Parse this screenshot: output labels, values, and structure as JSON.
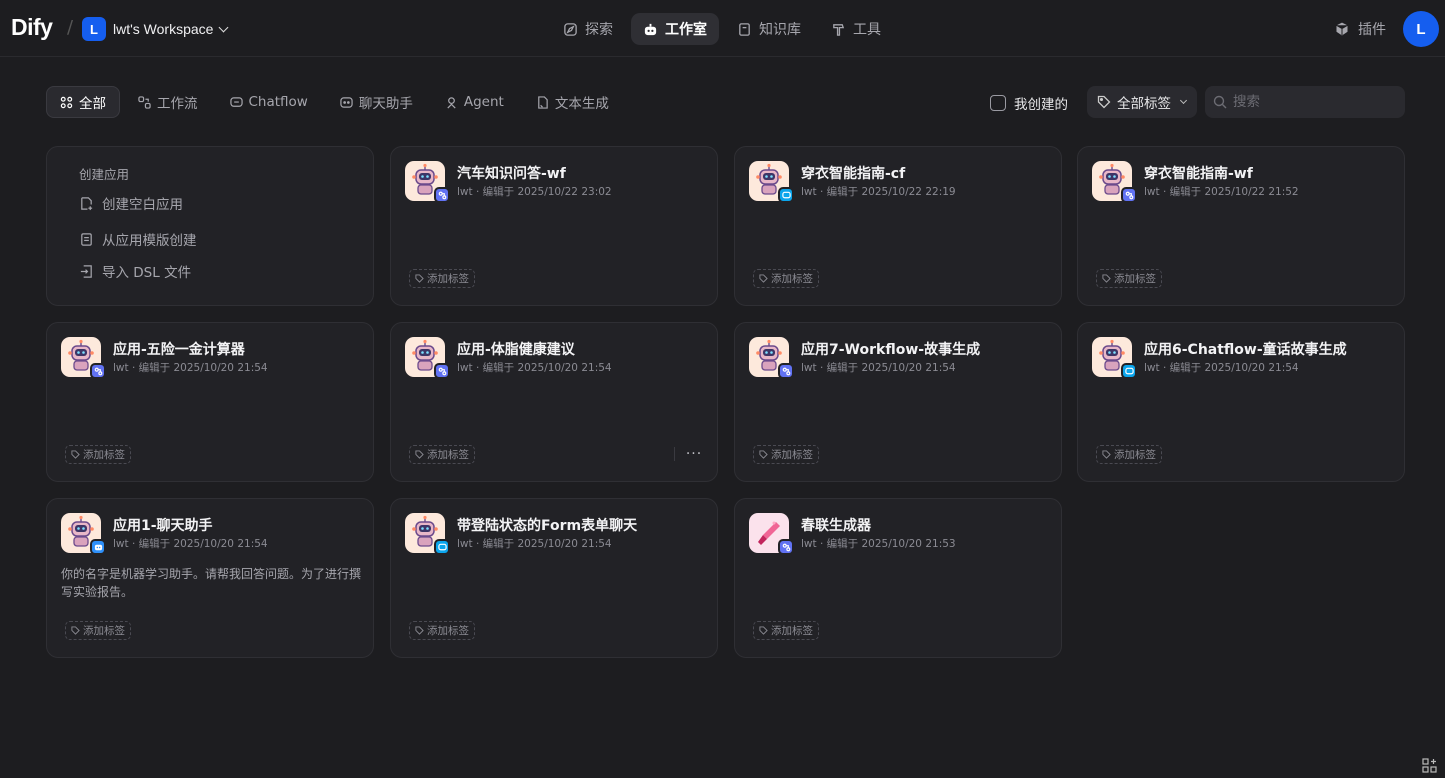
{
  "header": {
    "logo": "Dify",
    "workspace_initial": "L",
    "workspace_name": "lwt's Workspace",
    "nav": [
      {
        "label": "探索",
        "icon": "compass-icon"
      },
      {
        "label": "工作室",
        "icon": "robot-icon",
        "active": true
      },
      {
        "label": "知识库",
        "icon": "book-icon"
      },
      {
        "label": "工具",
        "icon": "hammer-icon"
      }
    ],
    "plugins_label": "插件",
    "avatar_initial": "L"
  },
  "filters": {
    "tabs": [
      {
        "label": "全部",
        "active": true
      },
      {
        "label": "工作流"
      },
      {
        "label": "Chatflow"
      },
      {
        "label": "聊天助手"
      },
      {
        "label": "Agent"
      },
      {
        "label": "文本生成"
      }
    ],
    "mine_label": "我创建的",
    "tags_label": "全部标签",
    "search_placeholder": "搜索"
  },
  "create": {
    "title": "创建应用",
    "blank": "创建空白应用",
    "template": "从应用模版创建",
    "import": "导入 DSL 文件"
  },
  "apps": [
    {
      "name": "汽车知识问答-wf",
      "meta": "lwt · 编辑于 2025/10/22 23:02",
      "type": "workflow",
      "tag": "添加标签"
    },
    {
      "name": "穿衣智能指南-cf",
      "meta": "lwt · 编辑于 2025/10/22 22:19",
      "type": "chatflow",
      "tag": "添加标签"
    },
    {
      "name": "穿衣智能指南-wf",
      "meta": "lwt · 编辑于 2025/10/22 21:52",
      "type": "workflow",
      "tag": "添加标签"
    },
    {
      "name": "应用-五险一金计算器",
      "meta": "lwt · 编辑于 2025/10/20 21:54",
      "type": "workflow",
      "tag": "添加标签"
    },
    {
      "name": "应用-体脂健康建议",
      "meta": "lwt · 编辑于 2025/10/20 21:54",
      "type": "workflow",
      "tag": "添加标签"
    },
    {
      "name": "应用7-Workflow-故事生成",
      "meta": "lwt · 编辑于 2025/10/20 21:54",
      "type": "workflow",
      "tag": "添加标签"
    },
    {
      "name": "应用6-Chatflow-童话故事生成",
      "meta": "lwt · 编辑于 2025/10/20 21:54",
      "type": "chatflow",
      "tag": "添加标签"
    },
    {
      "name": "应用1-聊天助手",
      "meta": "lwt · 编辑于 2025/10/20 21:54",
      "type": "assistant",
      "desc": "你的名字是机器学习助手。请帮我回答问题。为了进行撰写实验报告。",
      "tag": "添加标签"
    },
    {
      "name": "带登陆状态的Form表单聊天",
      "meta": "lwt · 编辑于 2025/10/20 21:54",
      "type": "chatflow",
      "tag": "添加标签"
    },
    {
      "name": "春联生成器",
      "meta": "lwt · 编辑于 2025/10/20 21:53",
      "type": "workflow",
      "tag": "添加标签"
    }
  ],
  "more_label": "···"
}
